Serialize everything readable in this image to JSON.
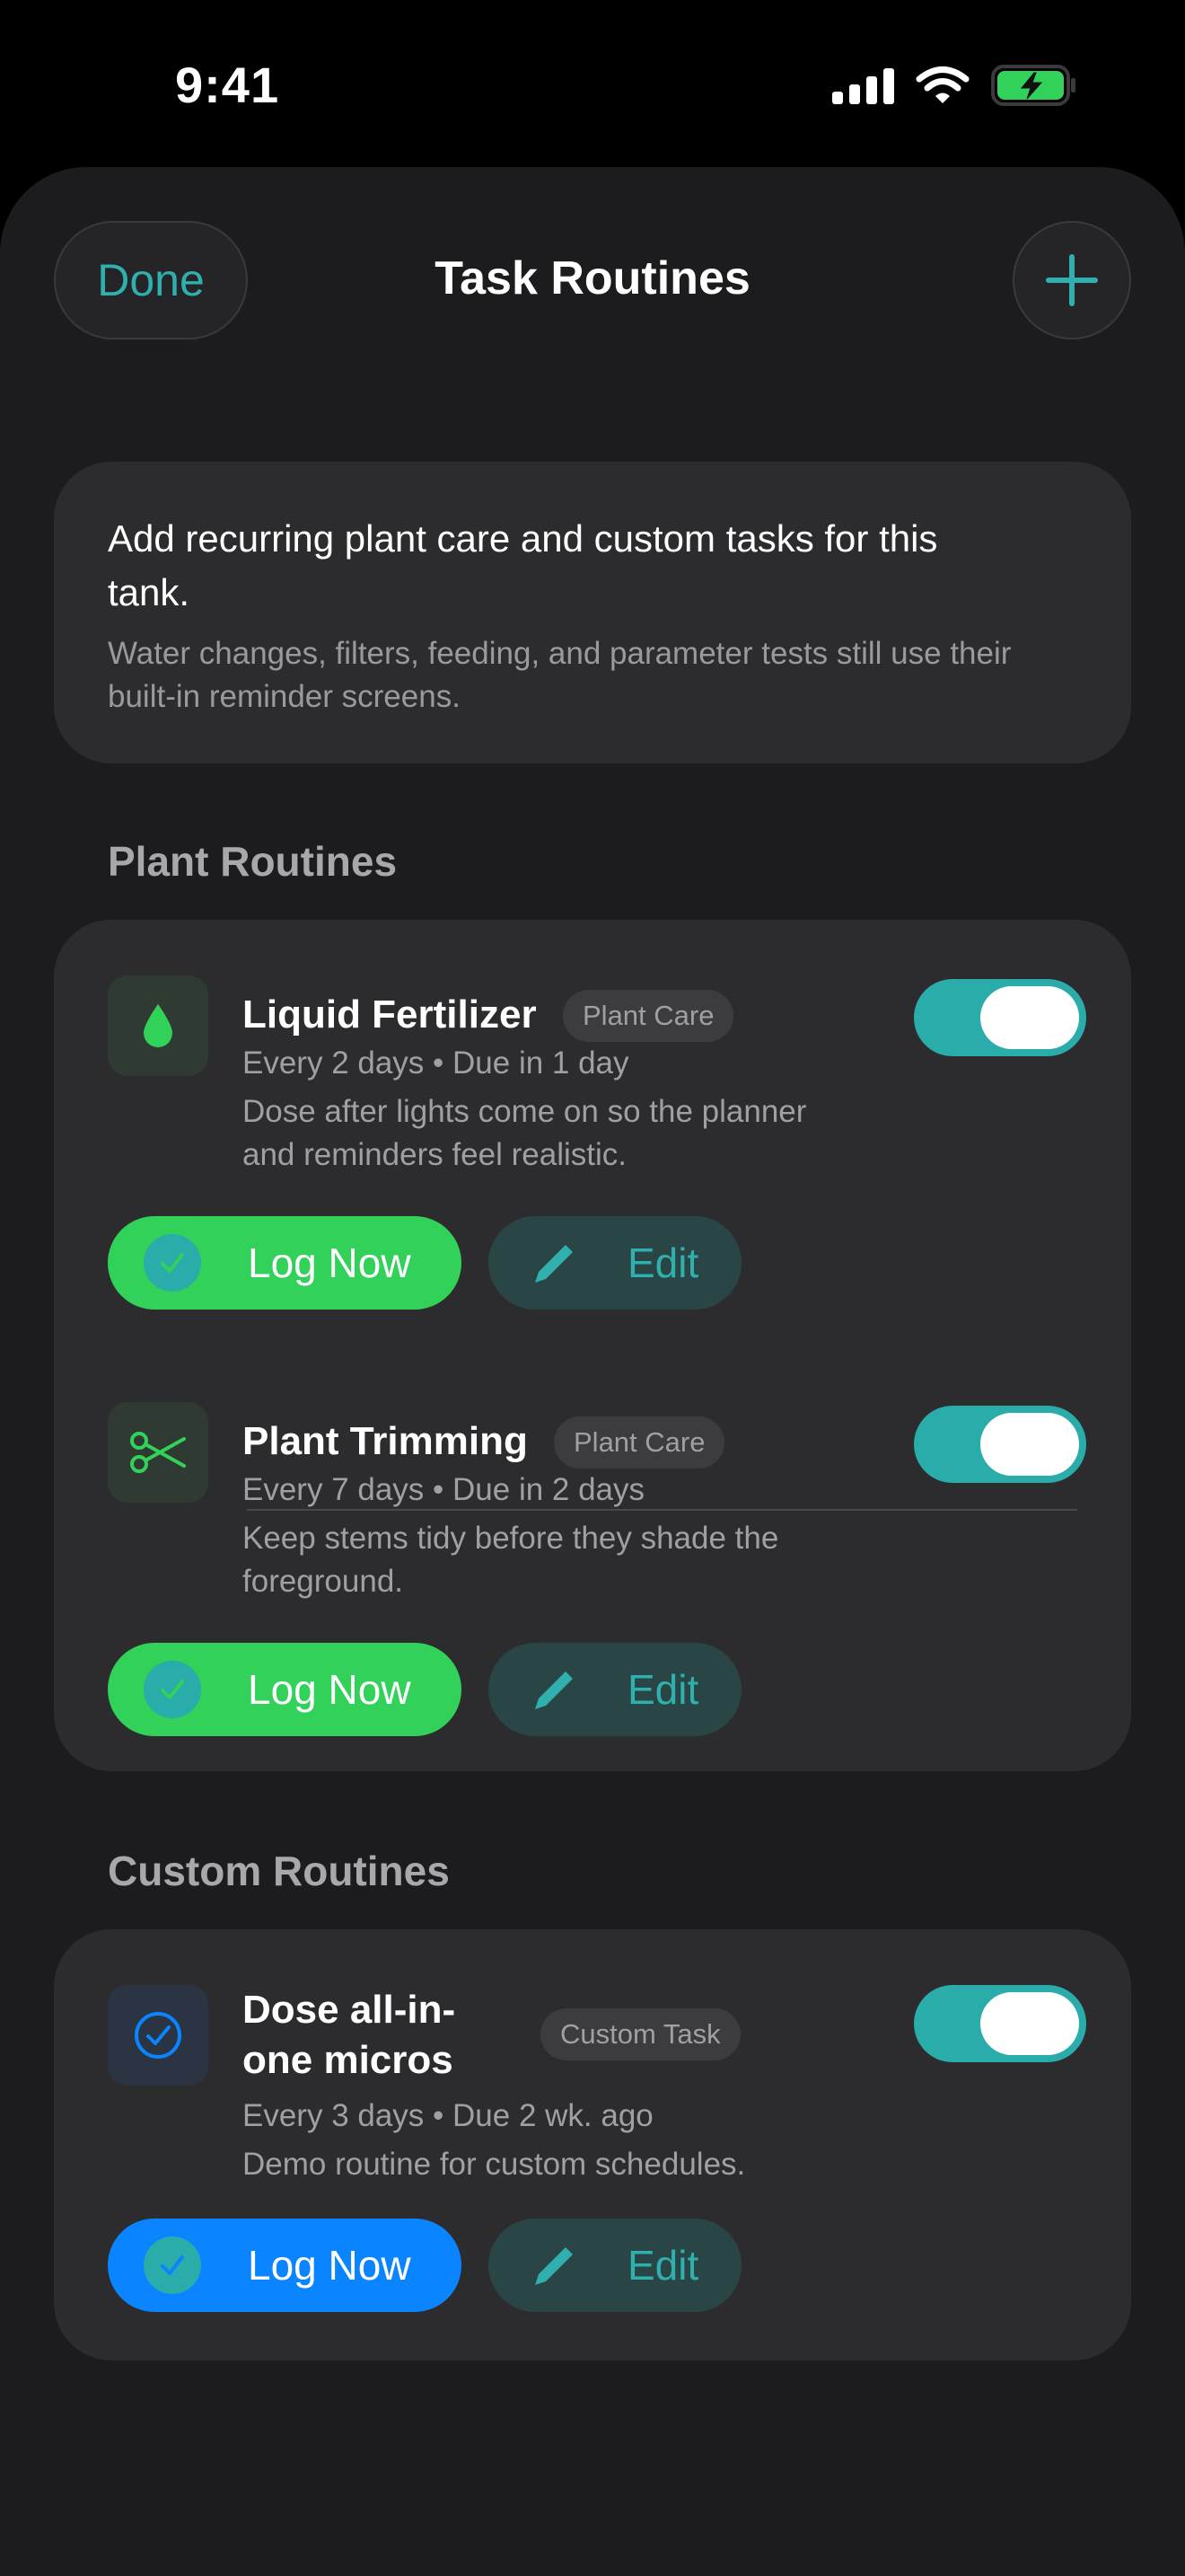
{
  "status_bar": {
    "time": "9:41"
  },
  "nav": {
    "done_label": "Done",
    "title": "Task Routines",
    "add_icon": "plus-icon"
  },
  "info": {
    "title": "Add recurring plant care and custom tasks for this tank.",
    "subtitle": "Water changes, filters, feeding, and parameter tests still use their built-in reminder screens."
  },
  "sections": {
    "plant_label": "Plant Routines",
    "custom_label": "Custom Routines"
  },
  "routines": [
    {
      "title": "Liquid Fertilizer",
      "badge": "Plant Care",
      "meta": "Every 2 days • Due in 1 day",
      "description": "Dose after lights come on so the planner and reminders feel realistic.",
      "enabled": true,
      "icon": "drop-icon",
      "log_label": "Log Now",
      "edit_label": "Edit"
    },
    {
      "title": "Plant Trimming",
      "badge": "Plant Care",
      "meta": "Every 7 days • Due in 2 days",
      "description": "Keep stems tidy before they shade the foreground.",
      "enabled": true,
      "icon": "scissors-icon",
      "log_label": "Log Now",
      "edit_label": "Edit"
    },
    {
      "title": "Dose all-in-one micros",
      "badge": "Custom Task",
      "meta": "Every 3 days • Due 2 wk. ago",
      "description": "Demo routine for custom schedules.",
      "enabled": true,
      "icon": "checkmark-circle-icon",
      "log_label": "Log Now",
      "edit_label": "Edit"
    }
  ],
  "colors": {
    "accent_teal": "#2aacaa",
    "log_green": "#32d159",
    "log_blue": "#0a84ff",
    "icon_green": "#32d159",
    "icon_blue": "#0a84ff"
  }
}
